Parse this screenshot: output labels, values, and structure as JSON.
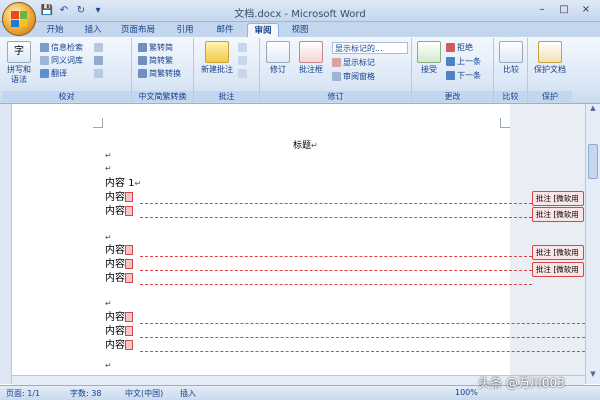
{
  "window": {
    "title": "文档.docx - Microsoft Word",
    "controls": [
      "–",
      "□",
      "×"
    ]
  },
  "quick_access": [
    "save-icon",
    "undo-icon",
    "redo-icon",
    "dropdown-icon"
  ],
  "tabs": [
    "开始",
    "插入",
    "页面布局",
    "引用",
    "邮件",
    "审阅",
    "视图"
  ],
  "active_tab": "审阅",
  "ribbon": {
    "proofing": {
      "label": "校对",
      "spell": "拼写和语法",
      "research": "信息检索",
      "thesaurus": "同义词库",
      "translate": "翻译"
    },
    "chinese": {
      "label": "中文简繁转换",
      "to_simplified": "繁转简",
      "to_traditional": "简转繁",
      "convert": "简繁转换"
    },
    "comments": {
      "label": "批注",
      "new_comment": "新建批注"
    },
    "tracking": {
      "label": "修订",
      "track": "修订",
      "balloons": "批注框",
      "show_markup_final": "显示标记的...",
      "show_markup": "显示标记",
      "reviewing_pane": "审阅窗格"
    },
    "changes": {
      "label": "更改",
      "accept": "接受",
      "reject": "拒绝",
      "previous": "上一条",
      "next": "下一条"
    },
    "compare": {
      "label": "比较",
      "compare": "比较"
    },
    "protect": {
      "label": "保护",
      "protect_doc": "保护文档"
    }
  },
  "document": {
    "title": "标题",
    "lines": [
      "内容 1",
      "内容",
      "内容",
      "内容",
      "内容",
      "内容",
      "内容",
      "内容",
      "内容"
    ],
    "comment_text": "批注 [微软用"
  },
  "status": {
    "page": "页面: 1/1",
    "words": "字数: 38",
    "language": "中文(中国)",
    "mode": "插入",
    "zoom": "100%"
  },
  "watermark": "头条 @万川003"
}
